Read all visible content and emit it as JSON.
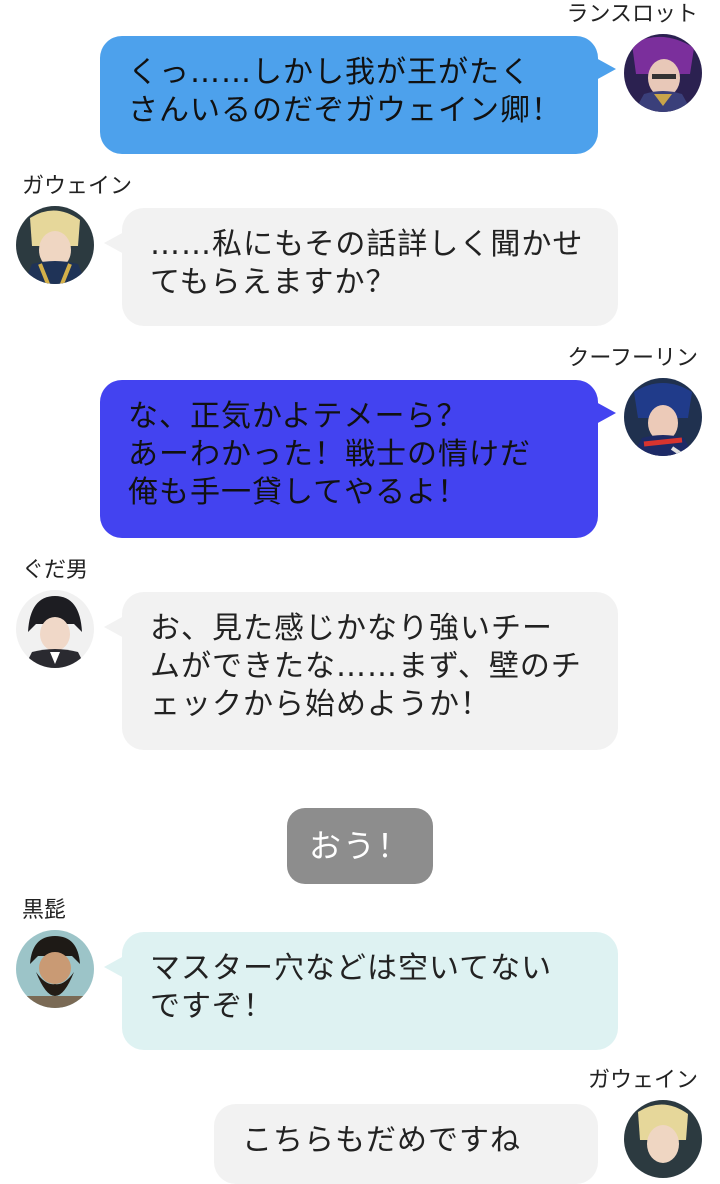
{
  "colors": {
    "lancelot_bubble": "#4da1ec",
    "cu_bubble": "#4343f0",
    "left_bubble": "#f2f2f2",
    "blackbeard_bubble": "#def2f2",
    "center_bubble": "#8d8d8d"
  },
  "messages": [
    {
      "sender": "ランスロット",
      "avatar": "lancelot-avatar-icon",
      "side": "right",
      "lines": [
        "くっ……しかし我が王がたく",
        "さんいるのだぞガウェイン卿！"
      ]
    },
    {
      "sender": "ガウェイン",
      "avatar": "gawain-avatar-icon",
      "side": "left",
      "lines": [
        "……私にもその話詳しく聞かせ",
        "てもらえますか？"
      ]
    },
    {
      "sender": "クーフーリン",
      "avatar": "cu-chulainn-avatar-icon",
      "side": "right",
      "lines": [
        "な、正気かよテメーら？",
        "あーわかった！戦士の情けだ",
        "俺も手一貸してやるよ！"
      ]
    },
    {
      "sender": "ぐだ男",
      "avatar": "gudao-avatar-icon",
      "side": "left",
      "lines": [
        "お、見た感じかなり強いチー",
        "ムができたな……まず、壁のチ",
        "ェックから始めようか！"
      ]
    },
    {
      "sender": "",
      "side": "center",
      "lines": [
        "おう！"
      ]
    },
    {
      "sender": "黒髭",
      "avatar": "blackbeard-avatar-icon",
      "side": "left",
      "lines": [
        "マスター穴などは空いてない",
        "ですぞ！"
      ]
    },
    {
      "sender": "ガウェイン",
      "avatar": "gawain-avatar-icon",
      "side": "right",
      "lines": [
        "こちらもだめですね"
      ]
    }
  ]
}
